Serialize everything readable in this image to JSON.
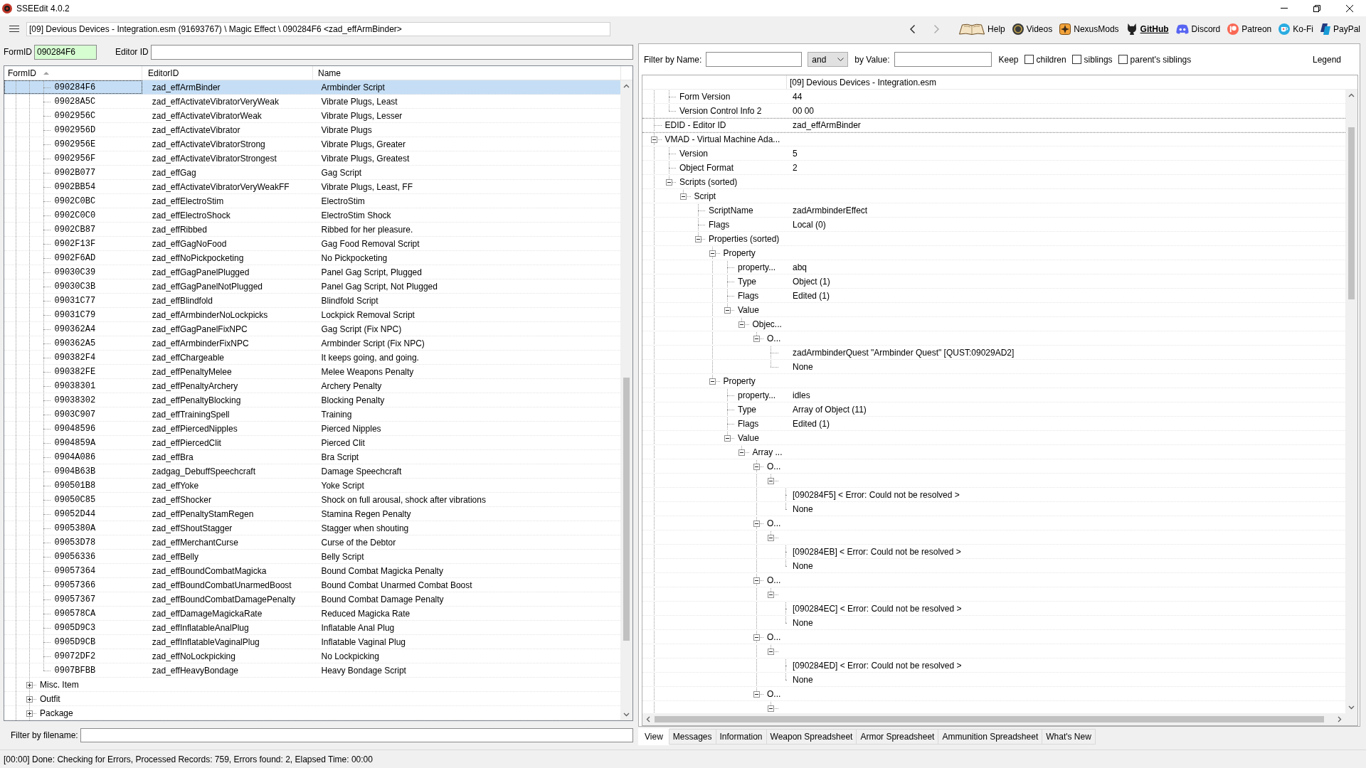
{
  "window": {
    "title": "SSEEdit 4.0.2"
  },
  "toolbar": {
    "path": "[09] Devious Devices - Integration.esm (91693767) \\ Magic Effect \\ 090284F6 <zad_effArmBinder>",
    "navigation": [
      {
        "kind": "back",
        "disabled": false
      },
      {
        "kind": "forward",
        "disabled": true
      }
    ],
    "links": [
      {
        "kind": "help",
        "label": "Help",
        "highlighted": false
      },
      {
        "kind": "videos",
        "label": "Videos",
        "highlighted": false
      },
      {
        "kind": "nexusmods",
        "label": "NexusMods",
        "highlighted": false
      },
      {
        "kind": "github",
        "label": "GitHub",
        "highlighted": true
      },
      {
        "kind": "discord",
        "label": "Discord",
        "highlighted": false
      },
      {
        "kind": "patreon",
        "label": "Patreon",
        "highlighted": false
      },
      {
        "kind": "kofi",
        "label": "Ko-Fi",
        "highlighted": false
      },
      {
        "kind": "paypal",
        "label": "PayPal",
        "highlighted": false
      }
    ]
  },
  "form_lookup": {
    "formid_label": "FormID",
    "formid_value": "090284F6",
    "valid": true,
    "editor_id_label": "Editor ID"
  },
  "record_filter": {
    "name_label": "Filter by Name:",
    "operator": "and",
    "value_label": "by Value:",
    "keep_label": "Keep",
    "keep_options": [
      {
        "label": "children",
        "checked": false
      },
      {
        "label": "siblings",
        "checked": false
      },
      {
        "label": "parent's siblings",
        "checked": false
      }
    ],
    "legend": "Legend"
  },
  "left_tree": {
    "columns": [
      {
        "label": "FormID",
        "sorted": true
      },
      {
        "label": "EditorID",
        "sorted": false
      },
      {
        "label": "Name",
        "sorted": false
      }
    ],
    "records": [
      {
        "formid": "090284F6",
        "editor_id": "zad_effArmBinder",
        "name": "Armbinder Script",
        "selected": true
      },
      {
        "formid": "09028A5C",
        "editor_id": "zad_effActivateVibratorVeryWeak",
        "name": "Vibrate Plugs, Least",
        "selected": false
      },
      {
        "formid": "0902956C",
        "editor_id": "zad_effActivateVibratorWeak",
        "name": "Vibrate Plugs, Lesser",
        "selected": false
      },
      {
        "formid": "0902956D",
        "editor_id": "zad_effActivateVibrator",
        "name": "Vibrate Plugs",
        "selected": false
      },
      {
        "formid": "0902956E",
        "editor_id": "zad_effActivateVibratorStrong",
        "name": "Vibrate Plugs, Greater",
        "selected": false
      },
      {
        "formid": "0902956F",
        "editor_id": "zad_effActivateVibratorStrongest",
        "name": "Vibrate Plugs, Greatest",
        "selected": false
      },
      {
        "formid": "0902B077",
        "editor_id": "zad_effGag",
        "name": "Gag Script",
        "selected": false
      },
      {
        "formid": "0902BB54",
        "editor_id": "zad_effActivateVibratorVeryWeakFF",
        "name": "Vibrate Plugs, Least, FF",
        "selected": false
      },
      {
        "formid": "0902C0BC",
        "editor_id": "zad_effElectroStim",
        "name": "ElectroStim",
        "selected": false
      },
      {
        "formid": "0902C0C0",
        "editor_id": "zad_effElectroShock",
        "name": "ElectroStim Shock",
        "selected": false
      },
      {
        "formid": "0902CB87",
        "editor_id": "zad_effRibbed",
        "name": "Ribbed for her pleasure.",
        "selected": false
      },
      {
        "formid": "0902F13F",
        "editor_id": "zad_effGagNoFood",
        "name": "Gag Food Removal Script",
        "selected": false
      },
      {
        "formid": "0902F6AD",
        "editor_id": "zad_effNoPickpocketing",
        "name": "No Pickpocketing",
        "selected": false
      },
      {
        "formid": "09030C39",
        "editor_id": "zad_effGagPanelPlugged",
        "name": "Panel Gag Script, Plugged",
        "selected": false
      },
      {
        "formid": "09030C3B",
        "editor_id": "zad_effGagPanelNotPlugged",
        "name": "Panel Gag Script, Not Plugged",
        "selected": false
      },
      {
        "formid": "09031C77",
        "editor_id": "zad_effBlindfold",
        "name": "Blindfold Script",
        "selected": false
      },
      {
        "formid": "09031C79",
        "editor_id": "zad_effArmbinderNoLockpicks",
        "name": "Lockpick Removal Script",
        "selected": false
      },
      {
        "formid": "090362A4",
        "editor_id": "zad_effGagPanelFixNPC",
        "name": "Gag Script (Fix NPC)",
        "selected": false
      },
      {
        "formid": "090362A5",
        "editor_id": "zad_effArmbinderFixNPC",
        "name": "Armbinder Script (Fix NPC)",
        "selected": false
      },
      {
        "formid": "090382F4",
        "editor_id": "zad_effChargeable",
        "name": "It keeps going, and going.",
        "selected": false
      },
      {
        "formid": "090382FE",
        "editor_id": "zad_effPenaltyMelee",
        "name": "Melee Weapons Penalty",
        "selected": false
      },
      {
        "formid": "09038301",
        "editor_id": "zad_effPenaltyArchery",
        "name": "Archery Penalty",
        "selected": false
      },
      {
        "formid": "09038302",
        "editor_id": "zad_effPenaltyBlocking",
        "name": "Blocking Penalty",
        "selected": false
      },
      {
        "formid": "0903C907",
        "editor_id": "zad_effTrainingSpell",
        "name": "Training",
        "selected": false
      },
      {
        "formid": "09048596",
        "editor_id": "zad_effPiercedNipples",
        "name": "Pierced Nipples",
        "selected": false
      },
      {
        "formid": "0904859A",
        "editor_id": "zad_effPiercedClit",
        "name": "Pierced Clit",
        "selected": false
      },
      {
        "formid": "0904A086",
        "editor_id": "zad_effBra",
        "name": "Bra Script",
        "selected": false
      },
      {
        "formid": "0904B63B",
        "editor_id": "zadgag_DebuffSpeechcraft",
        "name": "Damage Speechcraft",
        "selected": false
      },
      {
        "formid": "090501B8",
        "editor_id": "zad_effYoke",
        "name": "Yoke Script",
        "selected": false
      },
      {
        "formid": "09050C85",
        "editor_id": "zad_effShocker",
        "name": "Shock on full arousal, shock after vibrations",
        "selected": false
      },
      {
        "formid": "09052D44",
        "editor_id": "zad_effPenaltyStamRegen",
        "name": "Stamina Regen Penalty",
        "selected": false
      },
      {
        "formid": "0905380A",
        "editor_id": "zad_effShoutStagger",
        "name": "Stagger when shouting",
        "selected": false
      },
      {
        "formid": "09053D78",
        "editor_id": "zad_effMerchantCurse",
        "name": "Curse of the Debtor",
        "selected": false
      },
      {
        "formid": "09056336",
        "editor_id": "zad_effBelly",
        "name": "Belly Script",
        "selected": false
      },
      {
        "formid": "09057364",
        "editor_id": "zad_effBoundCombatMagicka",
        "name": "Bound Combat Magicka Penalty",
        "selected": false
      },
      {
        "formid": "09057366",
        "editor_id": "zad_effBoundCombatUnarmedBoost",
        "name": "Bound Combat Unarmed Combat Boost",
        "selected": false
      },
      {
        "formid": "09057367",
        "editor_id": "zad_effBoundCombatDamagePenalty",
        "name": "Bound Combat Damage Penalty",
        "selected": false
      },
      {
        "formid": "090578CA",
        "editor_id": "zad_effDamageMagickaRate",
        "name": "Reduced Magicka Rate",
        "selected": false
      },
      {
        "formid": "0905D9C3",
        "editor_id": "zad_effInflatableAnalPlug",
        "name": "Inflatable Anal Plug",
        "selected": false
      },
      {
        "formid": "0905D9CB",
        "editor_id": "zad_effInflatableVaginalPlug",
        "name": "Inflatable Vaginal Plug",
        "selected": false
      },
      {
        "formid": "09072DF2",
        "editor_id": "zad_effNoLockpicking",
        "name": "No Lockpicking",
        "selected": false
      },
      {
        "formid": "0907BFBB",
        "editor_id": "zad_effHeavyBondage",
        "name": "Heavy Bondage Script",
        "selected": false
      }
    ],
    "groups": [
      {
        "label": "Misc. Item",
        "expanded": false
      },
      {
        "label": "Outfit",
        "expanded": false
      },
      {
        "label": "Package",
        "expanded": false
      }
    ]
  },
  "record_view": {
    "file_header": "[09] Devious Devices - Integration.esm",
    "continued_children": [
      {
        "label": "Form Version",
        "value": "44"
      },
      {
        "label": "Version Control Info 2",
        "value": "00 00"
      }
    ],
    "nodes": [
      {
        "label": "EDID - Editor ID",
        "value": "zad_effArmBinder"
      },
      {
        "label": "VMAD - Virtual Machine Ada...",
        "expanded": true,
        "children": [
          {
            "label": "Version",
            "value": "5"
          },
          {
            "label": "Object Format",
            "value": "2"
          },
          {
            "label": "Scripts (sorted)",
            "expanded": true,
            "children": [
              {
                "label": "Script",
                "expanded": true,
                "children": [
                  {
                    "label": "ScriptName",
                    "value": "zadArmbinderEffect"
                  },
                  {
                    "label": "Flags",
                    "value": "Local (0)"
                  },
                  {
                    "label": "Properties (sorted)",
                    "expanded": true,
                    "children": [
                      {
                        "label": "Property",
                        "expanded": true,
                        "children": [
                          {
                            "label": "property...",
                            "value": "abq"
                          },
                          {
                            "label": "Type",
                            "value": "Object (1)"
                          },
                          {
                            "label": "Flags",
                            "value": "Edited (1)"
                          },
                          {
                            "label": "Value",
                            "expanded": true,
                            "children": [
                              {
                                "label": "Objec...",
                                "expanded": true,
                                "children": [
                                  {
                                    "label": "O...",
                                    "expanded": true,
                                    "children": [
                                      {
                                        "value": "zadArmbinderQuest \"Armbinder Quest\" [QUST:09029AD2]"
                                      },
                                      {
                                        "value": "None"
                                      }
                                    ]
                                  }
                                ]
                              }
                            ]
                          }
                        ]
                      },
                      {
                        "label": "Property",
                        "expanded": true,
                        "children": [
                          {
                            "label": "property...",
                            "value": "idles"
                          },
                          {
                            "label": "Type",
                            "value": "Array of Object (11)"
                          },
                          {
                            "label": "Flags",
                            "value": "Edited (1)"
                          },
                          {
                            "label": "Value",
                            "expanded": true,
                            "children": [
                              {
                                "label": "Array ...",
                                "expanded": true,
                                "children": [
                                  {
                                    "label": "O...",
                                    "expanded": true,
                                    "children": [
                                      {
                                        "expanded": true,
                                        "children": [
                                          {
                                            "value": "[090284F5] < Error: Could not be resolved >"
                                          },
                                          {
                                            "value": "None"
                                          }
                                        ]
                                      }
                                    ]
                                  },
                                  {
                                    "label": "O...",
                                    "expanded": true,
                                    "children": [
                                      {
                                        "expanded": true,
                                        "children": [
                                          {
                                            "value": "[090284EB] < Error: Could not be resolved >"
                                          },
                                          {
                                            "value": "None"
                                          }
                                        ]
                                      }
                                    ]
                                  },
                                  {
                                    "label": "O...",
                                    "expanded": true,
                                    "children": [
                                      {
                                        "expanded": true,
                                        "children": [
                                          {
                                            "value": "[090284EC] < Error: Could not be resolved >"
                                          },
                                          {
                                            "value": "None"
                                          }
                                        ]
                                      }
                                    ]
                                  },
                                  {
                                    "label": "O...",
                                    "expanded": true,
                                    "children": [
                                      {
                                        "expanded": true,
                                        "children": [
                                          {
                                            "value": "[090284ED] < Error: Could not be resolved >"
                                          },
                                          {
                                            "value": "None"
                                          }
                                        ]
                                      }
                                    ]
                                  },
                                  {
                                    "label": "O...",
                                    "expanded": true,
                                    "children": [
                                      {
                                        "expanded": true
                                      }
                                    ]
                                  }
                                ]
                              }
                            ]
                          }
                        ]
                      }
                    ]
                  }
                ]
              }
            ]
          }
        ]
      }
    ]
  },
  "filename_filter": {
    "label": "Filter by filename:"
  },
  "tabs": [
    {
      "label": "View",
      "selected": true
    },
    {
      "label": "Messages",
      "selected": false
    },
    {
      "label": "Information",
      "selected": false
    },
    {
      "label": "Weapon Spreadsheet",
      "selected": false
    },
    {
      "label": "Armor Spreadsheet",
      "selected": false
    },
    {
      "label": "Ammunition Spreadsheet",
      "selected": false
    },
    {
      "label": "What's New",
      "selected": false
    }
  ],
  "status_bar": {
    "text": "[00:00] Done: Checking for Errors, Processed Records: 759, Errors found: 2, Elapsed Time: 00:00"
  }
}
